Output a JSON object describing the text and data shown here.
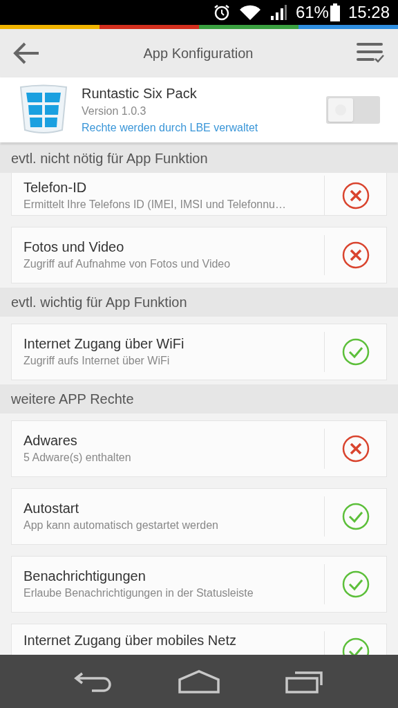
{
  "status_bar": {
    "battery": "61%",
    "time": "15:28"
  },
  "toolbar": {
    "title": "App Konfiguration"
  },
  "app": {
    "name": "Runtastic Six Pack",
    "version": "Version 1.0.3",
    "note": "Rechte werden durch LBE verwaltet",
    "on": false
  },
  "sections": [
    {
      "title": "evtl. nicht nötig für App Funktion",
      "permissions": [
        {
          "title": "Telefon-ID",
          "description": "Ermittelt Ihre Telefons ID (IMEI, IMSI und Telefonnu…",
          "allowed": false
        },
        {
          "title": "Fotos und Video",
          "description": "Zugriff auf Aufnahme von Fotos und Video",
          "allowed": false
        }
      ]
    },
    {
      "title": "evtl. wichtig für App Funktion",
      "permissions": [
        {
          "title": "Internet Zugang über WiFi",
          "description": "Zugriff aufs Internet über WiFi",
          "allowed": true
        }
      ]
    },
    {
      "title": "weitere APP Rechte",
      "permissions": [
        {
          "title": "Adwares",
          "description": "5 Adware(s) enthalten",
          "allowed": false
        },
        {
          "title": "Autostart",
          "description": "App kann automatisch gestartet werden",
          "allowed": true
        },
        {
          "title": "Benachrichtigungen",
          "description": "Erlaube Benachrichtigungen in der Statusleiste",
          "allowed": true
        },
        {
          "title": "Internet Zugang über mobiles Netz",
          "allowed": true
        }
      ]
    }
  ]
}
